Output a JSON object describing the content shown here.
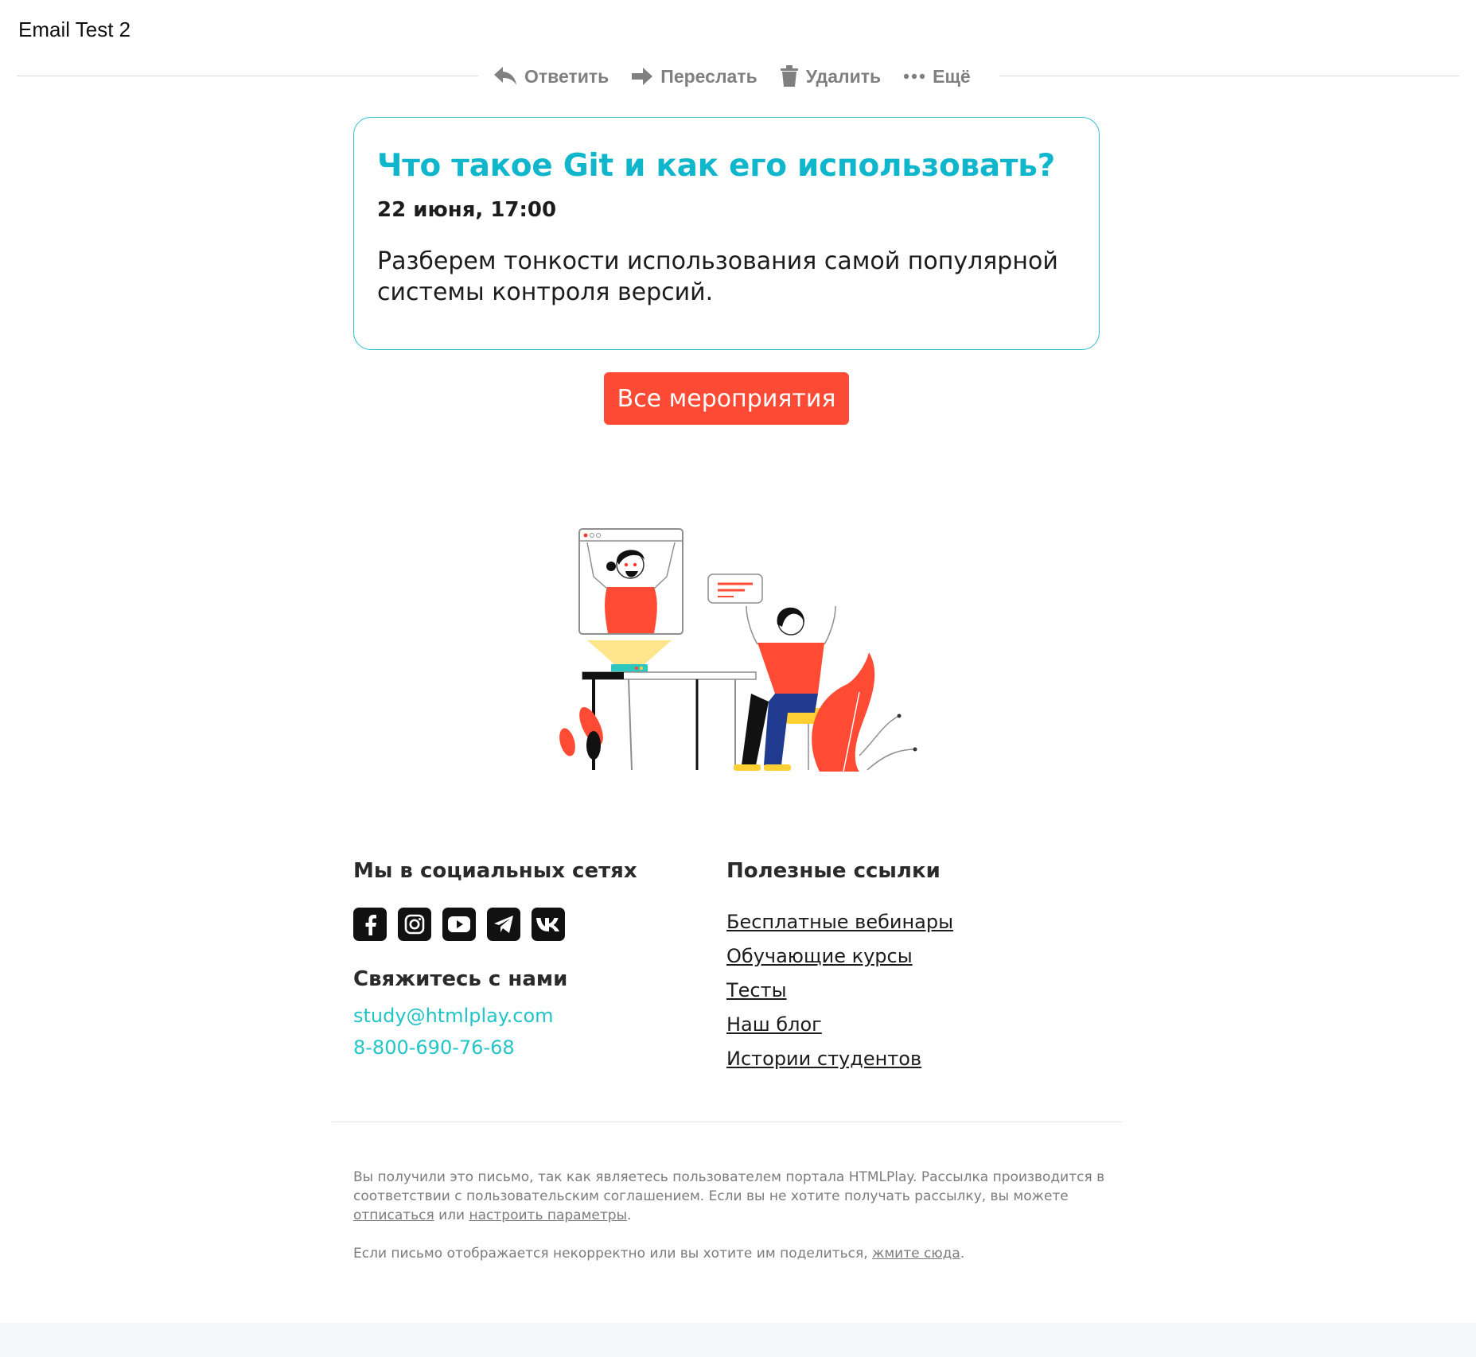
{
  "email": {
    "subject": "Email Test 2"
  },
  "toolbar": {
    "reply_label": "Ответить",
    "forward_label": "Переслать",
    "delete_label": "Удалить",
    "more_label": "Ещё",
    "icons": [
      "reply-icon",
      "forward-icon",
      "trash-icon",
      "more-dots-icon"
    ]
  },
  "event": {
    "title": "Что такое Git и как его использовать?",
    "date": "22 июня, 17:00",
    "description": "Разберем тонкости использования самой популярной системы контроля версий."
  },
  "cta": {
    "label": "Все мероприятия",
    "color": "#fd4a34"
  },
  "social": {
    "heading": "Мы в социальных сетях",
    "icons": [
      "facebook-icon",
      "instagram-icon",
      "youtube-icon",
      "telegram-icon",
      "vk-icon"
    ]
  },
  "contact": {
    "heading": "Свяжитесь с нами",
    "email": "study@htmlplay.com",
    "phone": "8-800-690-76-68"
  },
  "useful_links": {
    "heading": "Полезные ссылки",
    "items": [
      "Бесплатные вебинары",
      "Обучающие курсы",
      "Тесты",
      "Наш блог",
      "Истории студентов"
    ]
  },
  "legal": {
    "notice_text": "Вы получили это письмо, так как являетесь пользователем портала HTMLPlay. Рассылка производится в соответствии с пользовательским соглашением. Если вы не хотите получать рассылку, вы можете ",
    "unsubscribe_link": "отписаться",
    "or_text": " или ",
    "settings_link": "настроить параметры",
    "period": ".",
    "display_text": "Если письмо отображается некорректно или вы хотите им поделиться, ",
    "click_here_link": "жмите сюда",
    "display_period": "."
  },
  "colors": {
    "accent_teal": "#10b6cc",
    "link_teal": "#22c4c7",
    "cta_red": "#fd4a34"
  }
}
